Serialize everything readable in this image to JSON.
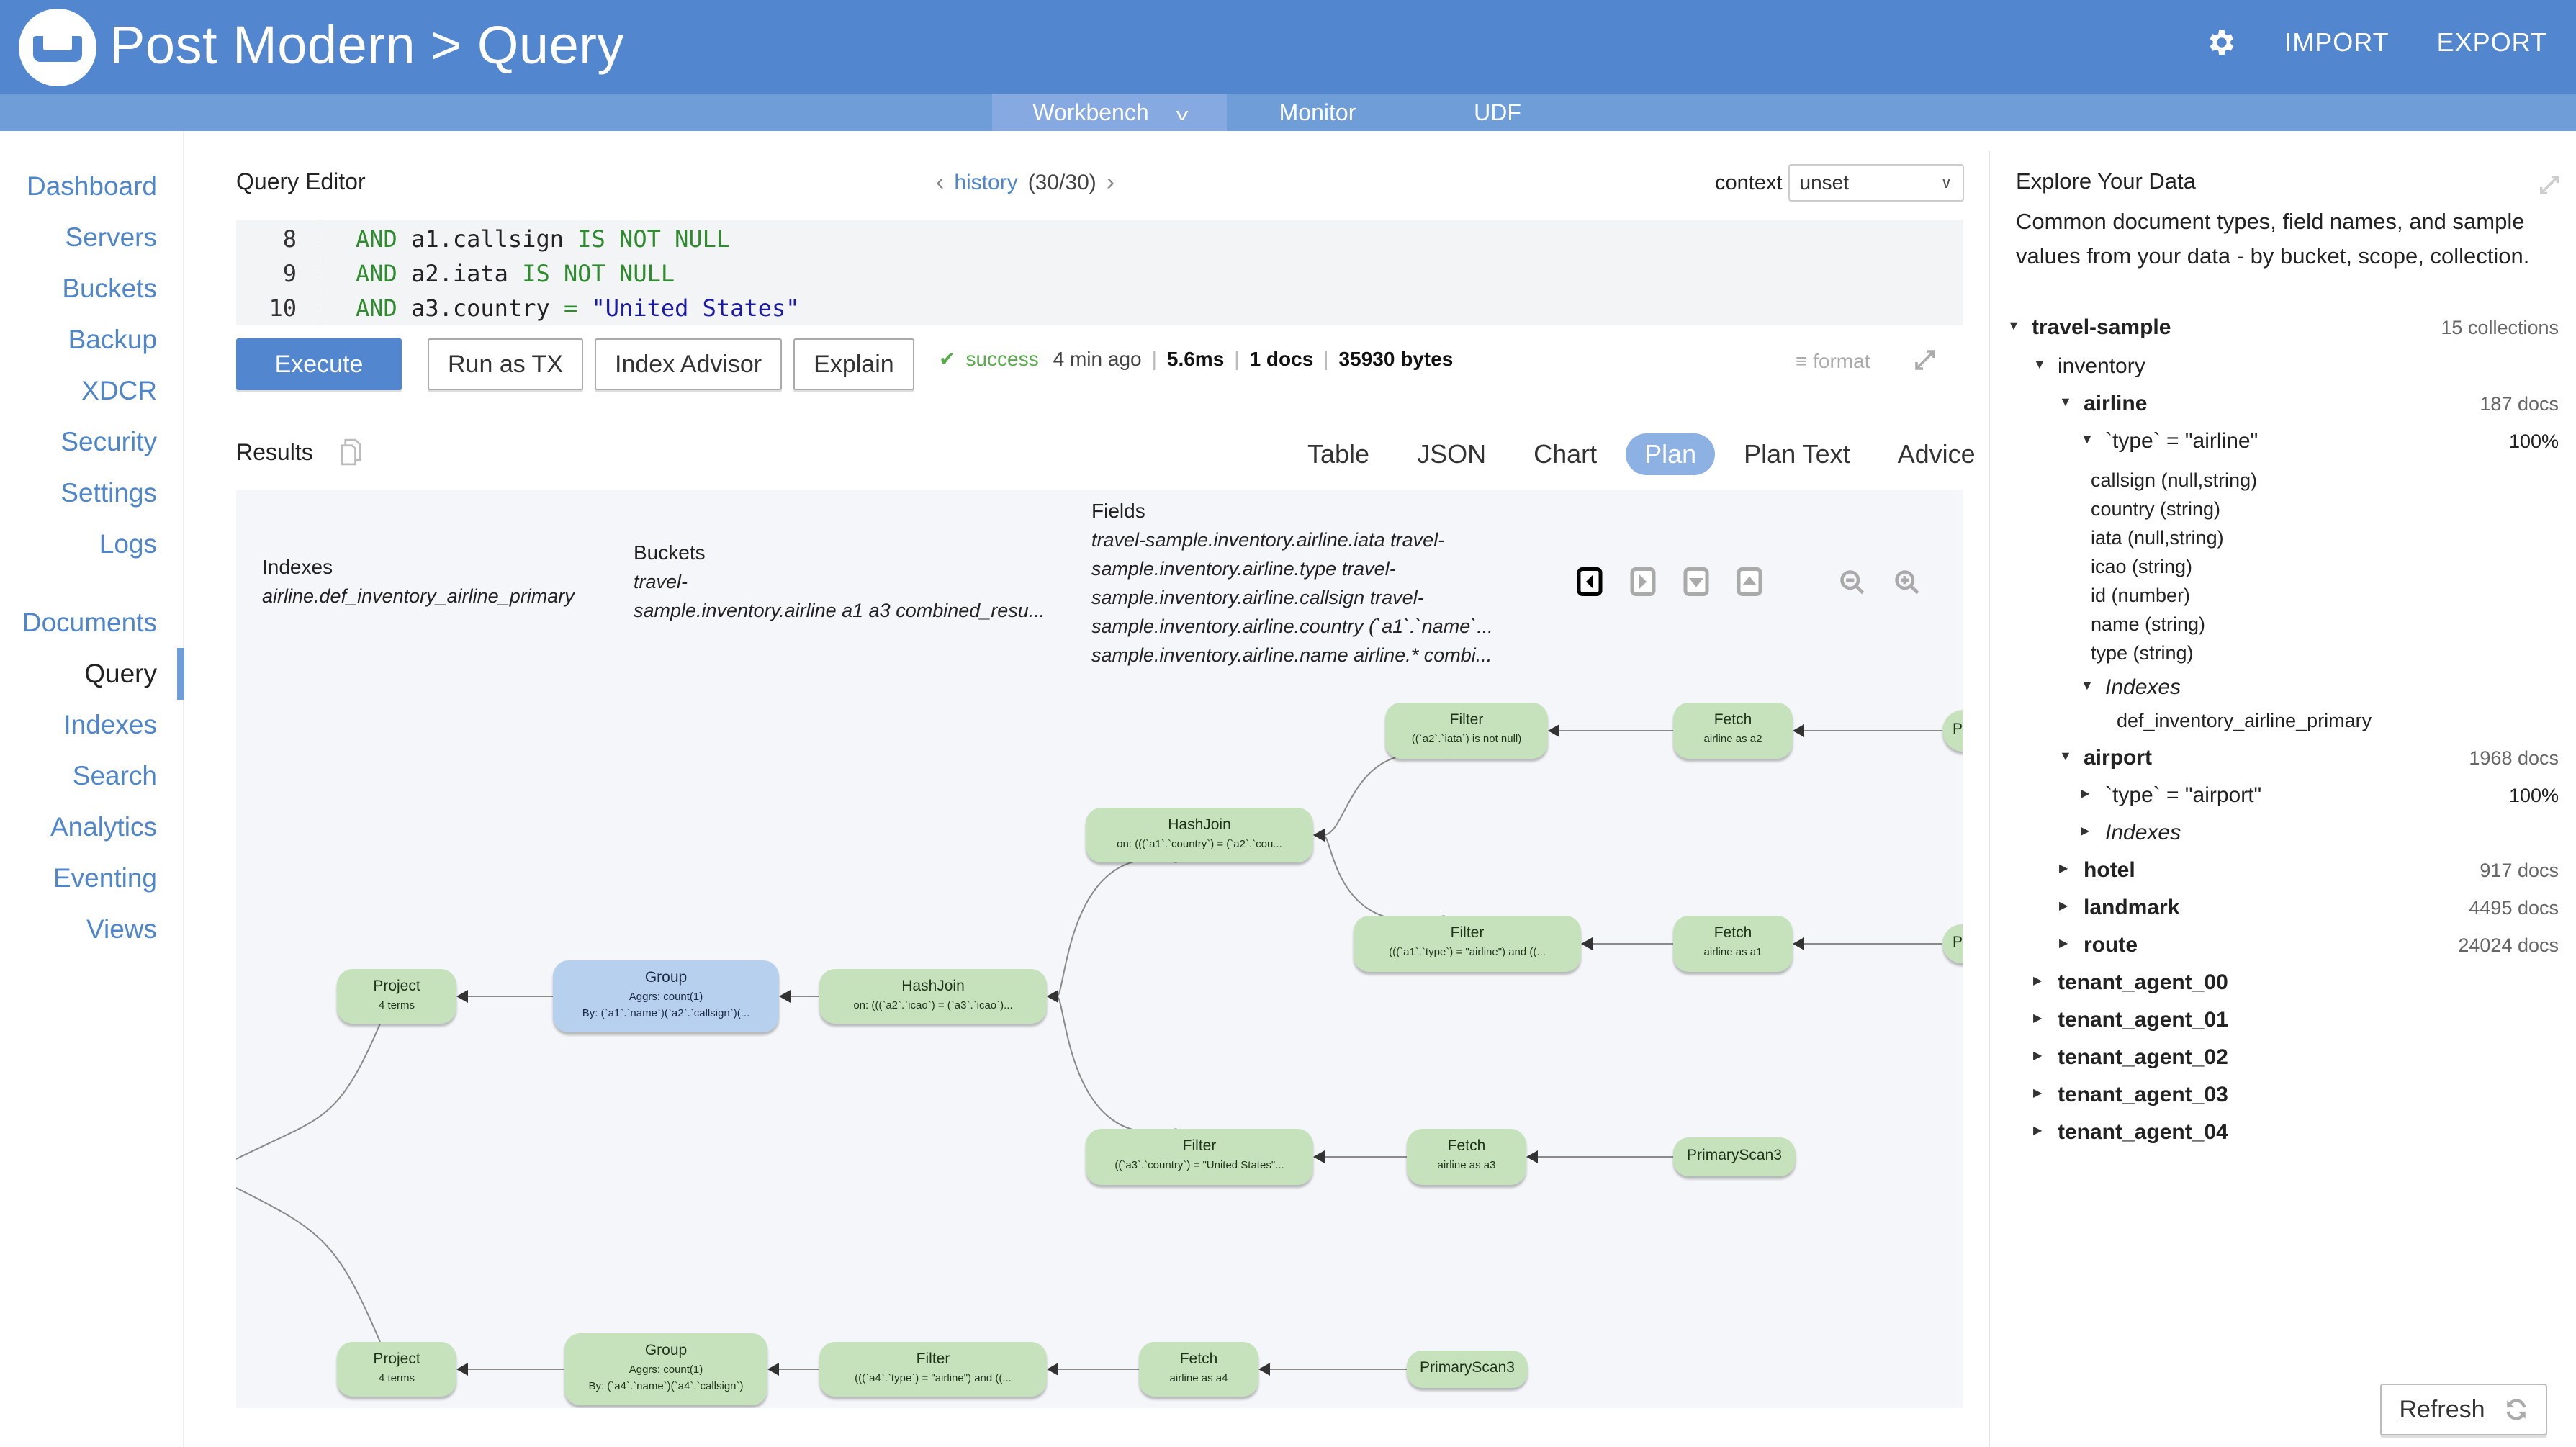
{
  "header": {
    "app_title": "Post Modern > Query",
    "settings_icon": "gear-icon",
    "links": [
      "IMPORT",
      "EXPORT"
    ]
  },
  "subnav": {
    "items": [
      {
        "label": "Workbench",
        "active": true,
        "has_dropdown": true
      },
      {
        "label": "Monitor",
        "active": false
      },
      {
        "label": "UDF",
        "active": false
      }
    ]
  },
  "leftnav": {
    "group1": [
      "Dashboard",
      "Servers",
      "Buckets",
      "Backup",
      "XDCR",
      "Security",
      "Settings",
      "Logs"
    ],
    "group2": [
      "Documents",
      "Query",
      "Indexes",
      "Search",
      "Analytics",
      "Eventing",
      "Views"
    ],
    "active": "Query"
  },
  "editor": {
    "title": "Query Editor",
    "history_link": "history",
    "history_count": "(30/30)",
    "context_label": "context",
    "context_value": "unset",
    "lines": [
      {
        "num": "8",
        "tokens": [
          {
            "t": "AND",
            "c": "kw"
          },
          {
            "t": " a1.callsign ",
            "c": "ident"
          },
          {
            "t": "IS NOT NULL",
            "c": "kw"
          }
        ]
      },
      {
        "num": "9",
        "tokens": [
          {
            "t": "AND",
            "c": "kw"
          },
          {
            "t": " a2.iata ",
            "c": "ident"
          },
          {
            "t": "IS NOT NULL",
            "c": "kw"
          }
        ]
      },
      {
        "num": "10",
        "tokens": [
          {
            "t": "AND",
            "c": "kw"
          },
          {
            "t": " a3.country ",
            "c": "ident"
          },
          {
            "t": "=",
            "c": "kw"
          },
          {
            "t": " \"United States\"",
            "c": "str"
          }
        ]
      }
    ],
    "buttons": {
      "execute": "Execute",
      "run_as_tx": "Run as TX",
      "index_advisor": "Index Advisor",
      "explain": "Explain"
    },
    "status": {
      "result": "success",
      "when": "4 min ago",
      "elapsed": "5.6ms",
      "docs": "1 docs",
      "size": "35930 bytes"
    },
    "format_label": "format"
  },
  "results": {
    "title": "Results",
    "tabs": [
      "Table",
      "JSON",
      "Chart",
      "Plan",
      "Plan Text",
      "Advice"
    ],
    "active_tab": "Plan",
    "plan": {
      "indexes_label": "Indexes",
      "indexes_value": "airline.def_inventory_airline_primary",
      "buckets_label": "Buckets",
      "buckets_lines": [
        "travel-",
        "sample.inventory.airline  a1  a3  combined_resu..."
      ],
      "fields_label": "Fields",
      "fields_lines": [
        "travel-sample.inventory.airline.iata  travel-",
        "sample.inventory.airline.type  travel-",
        "sample.inventory.airline.callsign  travel-",
        "sample.inventory.airline.country  (`a1`.`name`...",
        "sample.inventory.airline.name  airline.*  combi..."
      ],
      "nodes": [
        {
          "id": "p1",
          "title": "Project",
          "detail": [
            "4 terms"
          ]
        },
        {
          "id": "g1",
          "title": "Group",
          "detail": [
            "Aggrs: count(1)",
            "By: (`a1`.`name`)(`a2`.`callsign`)(..."
          ],
          "selected": true
        },
        {
          "id": "hj1",
          "title": "HashJoin",
          "detail": [
            "on: (((`a2`.`icao`) = (`a3`.`icao`)..."
          ]
        },
        {
          "id": "hj2",
          "title": "HashJoin",
          "detail": [
            "on: (((`a1`.`country`) = (`a2`.`cou..."
          ]
        },
        {
          "id": "f2",
          "title": "Filter",
          "detail": [
            "((`a2`.`iata`) is not null)"
          ]
        },
        {
          "id": "fe2",
          "title": "Fetch",
          "detail": [
            "airline as a2"
          ]
        },
        {
          "id": "f1",
          "title": "Filter",
          "detail": [
            "(((`a1`.`type`) = \"airline\") and ((..."
          ]
        },
        {
          "id": "fe1",
          "title": "Fetch",
          "detail": [
            "airline as a1"
          ]
        },
        {
          "id": "f3",
          "title": "Filter",
          "detail": [
            "((`a3`.`country`) = \"United States\"..."
          ]
        },
        {
          "id": "fe3",
          "title": "Fetch",
          "detail": [
            "airline as a3"
          ]
        },
        {
          "id": "ps3",
          "title": "PrimaryScan3",
          "detail": []
        },
        {
          "id": "p2",
          "title": "Project",
          "detail": [
            "4 terms"
          ]
        },
        {
          "id": "g2",
          "title": "Group",
          "detail": [
            "Aggrs: count(1)",
            "By: (`a4`.`name`)(`a4`.`callsign`)"
          ]
        },
        {
          "id": "f4",
          "title": "Filter",
          "detail": [
            "(((`a4`.`type`) = \"airline\") and ((..."
          ]
        },
        {
          "id": "fe4",
          "title": "Fetch",
          "detail": [
            "airline as a4"
          ]
        },
        {
          "id": "ps4",
          "title": "PrimaryScan3",
          "detail": []
        },
        {
          "id": "cut1",
          "title": "P",
          "detail": []
        },
        {
          "id": "cut2",
          "title": "P",
          "detail": []
        }
      ],
      "edges": [
        [
          "g1",
          "p1"
        ],
        [
          "hj1",
          "g1"
        ],
        [
          "hj2",
          "hj1"
        ],
        [
          "f3",
          "hj1"
        ],
        [
          "f2",
          "hj2"
        ],
        [
          "f1",
          "hj2"
        ],
        [
          "fe2",
          "f2"
        ],
        [
          "cut1",
          "fe2"
        ],
        [
          "fe1",
          "f1"
        ],
        [
          "cut2",
          "fe1"
        ],
        [
          "fe3",
          "f3"
        ],
        [
          "ps3",
          "fe3"
        ],
        [
          "g2",
          "p2"
        ],
        [
          "f4",
          "g2"
        ],
        [
          "fe4",
          "f4"
        ],
        [
          "ps4",
          "fe4"
        ]
      ]
    }
  },
  "explorer": {
    "title": "Explore Your Data",
    "description": "Common document types, field names, and sample values from your data - by bucket, scope, collection.",
    "tree": [
      {
        "level": 0,
        "label": "travel-sample",
        "bold": true,
        "open": true,
        "count": "15 collections"
      },
      {
        "level": 1,
        "label": "inventory",
        "bold": false,
        "open": true,
        "count": ""
      },
      {
        "level": 2,
        "label": "airline",
        "bold": true,
        "open": true,
        "count": "187 docs"
      },
      {
        "level": 3,
        "label": "`type` = \"airline\"",
        "open": true,
        "count": "100%"
      },
      {
        "level": 4,
        "label": "callsign (null,string)",
        "field": true
      },
      {
        "level": 4,
        "label": "country (string)",
        "field": true
      },
      {
        "level": 4,
        "label": "iata (null,string)",
        "field": true
      },
      {
        "level": 4,
        "label": "icao (string)",
        "field": true
      },
      {
        "level": 4,
        "label": "id (number)",
        "field": true
      },
      {
        "level": 4,
        "label": "name (string)",
        "field": true
      },
      {
        "level": 4,
        "label": "type (string)",
        "field": true
      },
      {
        "level": 3,
        "label": "Indexes",
        "italic": true,
        "open": true,
        "count": ""
      },
      {
        "level": 5,
        "label": "def_inventory_airline_primary",
        "field": true
      },
      {
        "level": 2,
        "label": "airport",
        "bold": true,
        "open": true,
        "count": "1968 docs"
      },
      {
        "level": 3,
        "label": "`type` = \"airport\"",
        "open": false,
        "count": "100%"
      },
      {
        "level": 3,
        "label": "Indexes",
        "italic": true,
        "open": false,
        "count": ""
      },
      {
        "level": 2,
        "label": "hotel",
        "bold": true,
        "open": false,
        "count": "917 docs"
      },
      {
        "level": 2,
        "label": "landmark",
        "bold": true,
        "open": false,
        "count": "4495 docs"
      },
      {
        "level": 2,
        "label": "route",
        "bold": true,
        "open": false,
        "count": "24024 docs"
      },
      {
        "level": 1,
        "label": "tenant_agent_00",
        "bold": true,
        "open": false,
        "count": ""
      },
      {
        "level": 1,
        "label": "tenant_agent_01",
        "bold": true,
        "open": false,
        "count": ""
      },
      {
        "level": 1,
        "label": "tenant_agent_02",
        "bold": true,
        "open": false,
        "count": ""
      },
      {
        "level": 1,
        "label": "tenant_agent_03",
        "bold": true,
        "open": false,
        "count": ""
      },
      {
        "level": 1,
        "label": "tenant_agent_04",
        "bold": true,
        "open": false,
        "count": ""
      }
    ],
    "refresh_label": "Refresh"
  },
  "colors": {
    "header": "#5286cf",
    "subnav": "#6f9dd8",
    "link": "#4f86cb",
    "success": "#5aaa4e",
    "node_green": "#c6e2bd",
    "node_selected": "#b7d0ee"
  }
}
